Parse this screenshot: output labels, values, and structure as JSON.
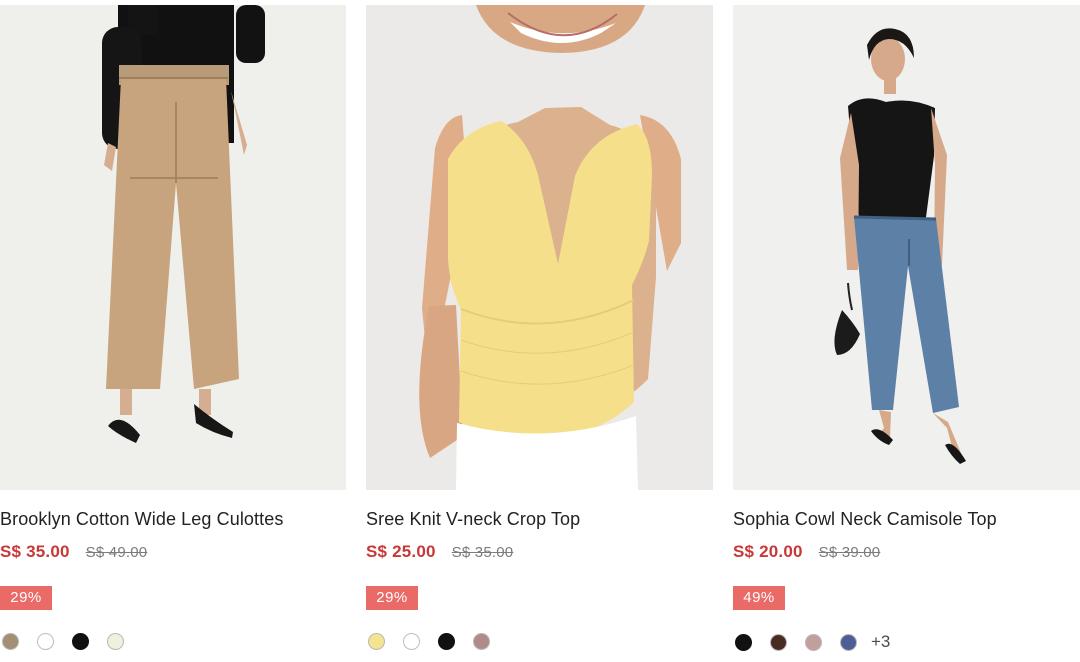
{
  "products": [
    {
      "name": "Brooklyn Cotton Wide Leg Culottes",
      "sale_price": "S$ 35.00",
      "original_price": "S$ 49.00",
      "discount": "29%",
      "swatches": [
        "#a38f73",
        "#ffffff",
        "#111111",
        "#f0f0df"
      ],
      "more_colors": ""
    },
    {
      "name": "Sree Knit V-neck Crop Top",
      "sale_price": "S$ 25.00",
      "original_price": "S$ 35.00",
      "discount": "29%",
      "swatches": [
        "#f5e48f",
        "#ffffff",
        "#111111",
        "#b18b8a"
      ],
      "more_colors": ""
    },
    {
      "name": "Sophia Cowl Neck Camisole Top",
      "sale_price": "S$ 20.00",
      "original_price": "S$ 39.00",
      "discount": "49%",
      "swatches": [
        "#111111",
        "#4a2b21",
        "#c49e9c",
        "#4f5d96"
      ],
      "more_colors": "+3"
    }
  ],
  "theme": {
    "accent": "#c73836",
    "badge": "#ea6a68"
  }
}
